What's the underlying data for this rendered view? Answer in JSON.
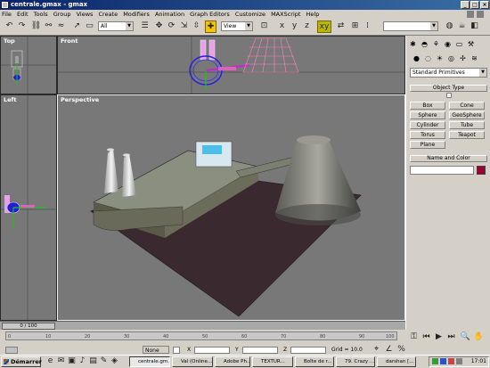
{
  "window": {
    "title": "centrale.gmax - gmax"
  },
  "menu": [
    "File",
    "Edit",
    "Tools",
    "Group",
    "Views",
    "Create",
    "Modifiers",
    "Animation",
    "Graph Editors",
    "Customize",
    "MAXScript",
    "Help"
  ],
  "toolbar": {
    "selection_filter": "All",
    "ref_coord": "View",
    "named_selection": ""
  },
  "viewports": {
    "top": "Top",
    "front": "Front",
    "left": "Left",
    "perspective": "Perspective"
  },
  "command_panel": {
    "category": "Standard Primitives",
    "object_type_header": "Object Type",
    "objects": [
      "Box",
      "Cone",
      "Sphere",
      "GeoSphere",
      "Cylinder",
      "Tube",
      "Torus",
      "Teapot",
      "Plane"
    ],
    "name_color_header": "Name and Color",
    "object_name": "",
    "object_color": "#a00030"
  },
  "timeline": {
    "frame_label": "0 / 100",
    "ticks": [
      "0",
      "10",
      "20",
      "30",
      "40",
      "50",
      "60",
      "70",
      "80",
      "90",
      "100"
    ]
  },
  "status": {
    "selection": "None",
    "x_label": "X",
    "y_label": "Y",
    "z_label": "Z",
    "grid": "Grid = 10.0"
  },
  "taskbar": {
    "start": "Démarrer",
    "tasks": [
      "centrale.gm...",
      "Val (Online...",
      "Adobe Ph...",
      "TEXTUR...",
      "Boîte de r...",
      "79. Crazy ...",
      "darshan [..."
    ],
    "clock": "17:01"
  },
  "colors": {
    "viewport_bg": "#787878",
    "active_border": "#f0f0f0",
    "title_start": "#0a246a",
    "title_end": "#3a6ea5"
  }
}
